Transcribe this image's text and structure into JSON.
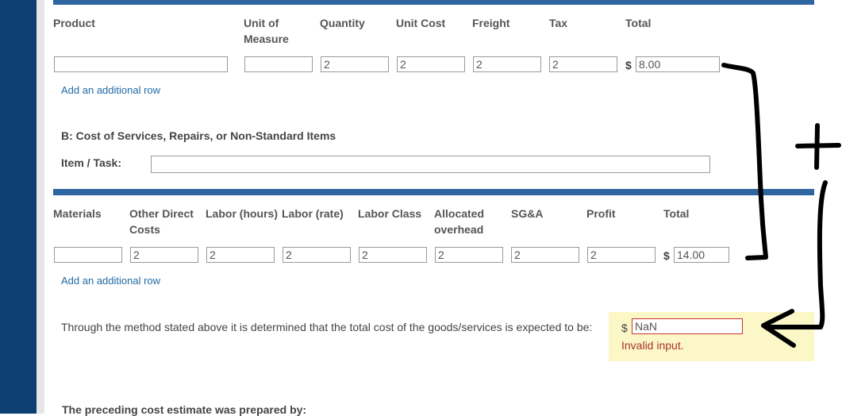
{
  "section_a": {
    "headers": [
      "Product",
      "Unit of Measure",
      "Quantity",
      "Unit Cost",
      "Freight",
      "Tax",
      "Total"
    ],
    "row": {
      "product": "",
      "unit_of_measure": "",
      "quantity": "2",
      "unit_cost": "2",
      "freight": "2",
      "tax": "2",
      "currency": "$",
      "total": "8.00"
    },
    "add_row_link": "Add an additional row"
  },
  "section_b": {
    "title": "B: Cost of Services, Repairs, or Non-Standard Items",
    "item_task_label": "Item / Task:",
    "item_task_value": "",
    "headers": [
      "Materials",
      "Other Direct Costs",
      "Labor (hours)",
      "Labor (rate)",
      "Labor Class",
      "Allocated overhead",
      "SG&A",
      "Profit",
      "Total"
    ],
    "row": {
      "materials": "",
      "other_direct_costs": "2",
      "labor_hours": "2",
      "labor_rate": "2",
      "labor_class": "2",
      "allocated_overhead": "2",
      "sga": "2",
      "profit": "2",
      "currency": "$",
      "total": "14.00"
    },
    "add_row_link": "Add an additional row"
  },
  "summary": {
    "statement": "Through the method stated above it is determined that the total cost of the goods/services is expected to be:",
    "currency": "$",
    "total_value": "NaN",
    "error_message": "Invalid input."
  },
  "footer": {
    "prepared_by_heading": "The preceding cost estimate was prepared by:"
  },
  "annotation": {
    "plus_symbol": "+",
    "ink_color": "#000000"
  },
  "colors": {
    "left_sidebar": "#0d3f73",
    "section_bar": "#2f65a0",
    "link": "#1f6aa5",
    "error": "#a83232",
    "highlight_box": "#fcf7c6"
  }
}
